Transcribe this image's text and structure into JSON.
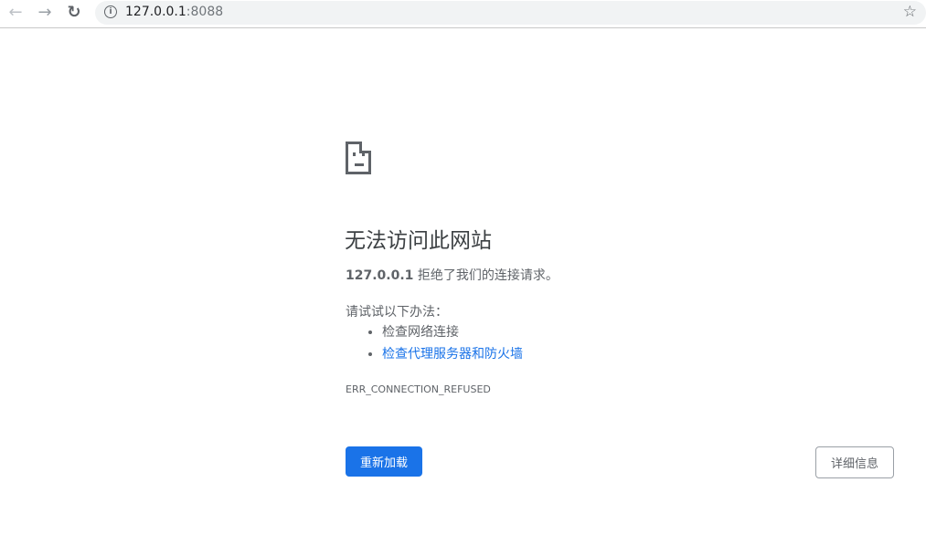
{
  "browser": {
    "back": "←",
    "forward": "→",
    "reload": "↻",
    "url_host": "127.0.0.1",
    "url_port": ":8088",
    "star": "☆",
    "info": "i"
  },
  "error": {
    "title": "无法访问此网站",
    "host": "127.0.0.1",
    "message": " 拒绝了我们的连接请求。",
    "try_label": "请试试以下办法：",
    "suggestions": [
      "检查网络连接",
      "检查代理服务器和防火墙"
    ],
    "code": "ERR_CONNECTION_REFUSED",
    "reload_button": "重新加载",
    "details_button": "详细信息"
  },
  "colors": {
    "accent": "#1a73e8",
    "text": "#5f6368"
  }
}
